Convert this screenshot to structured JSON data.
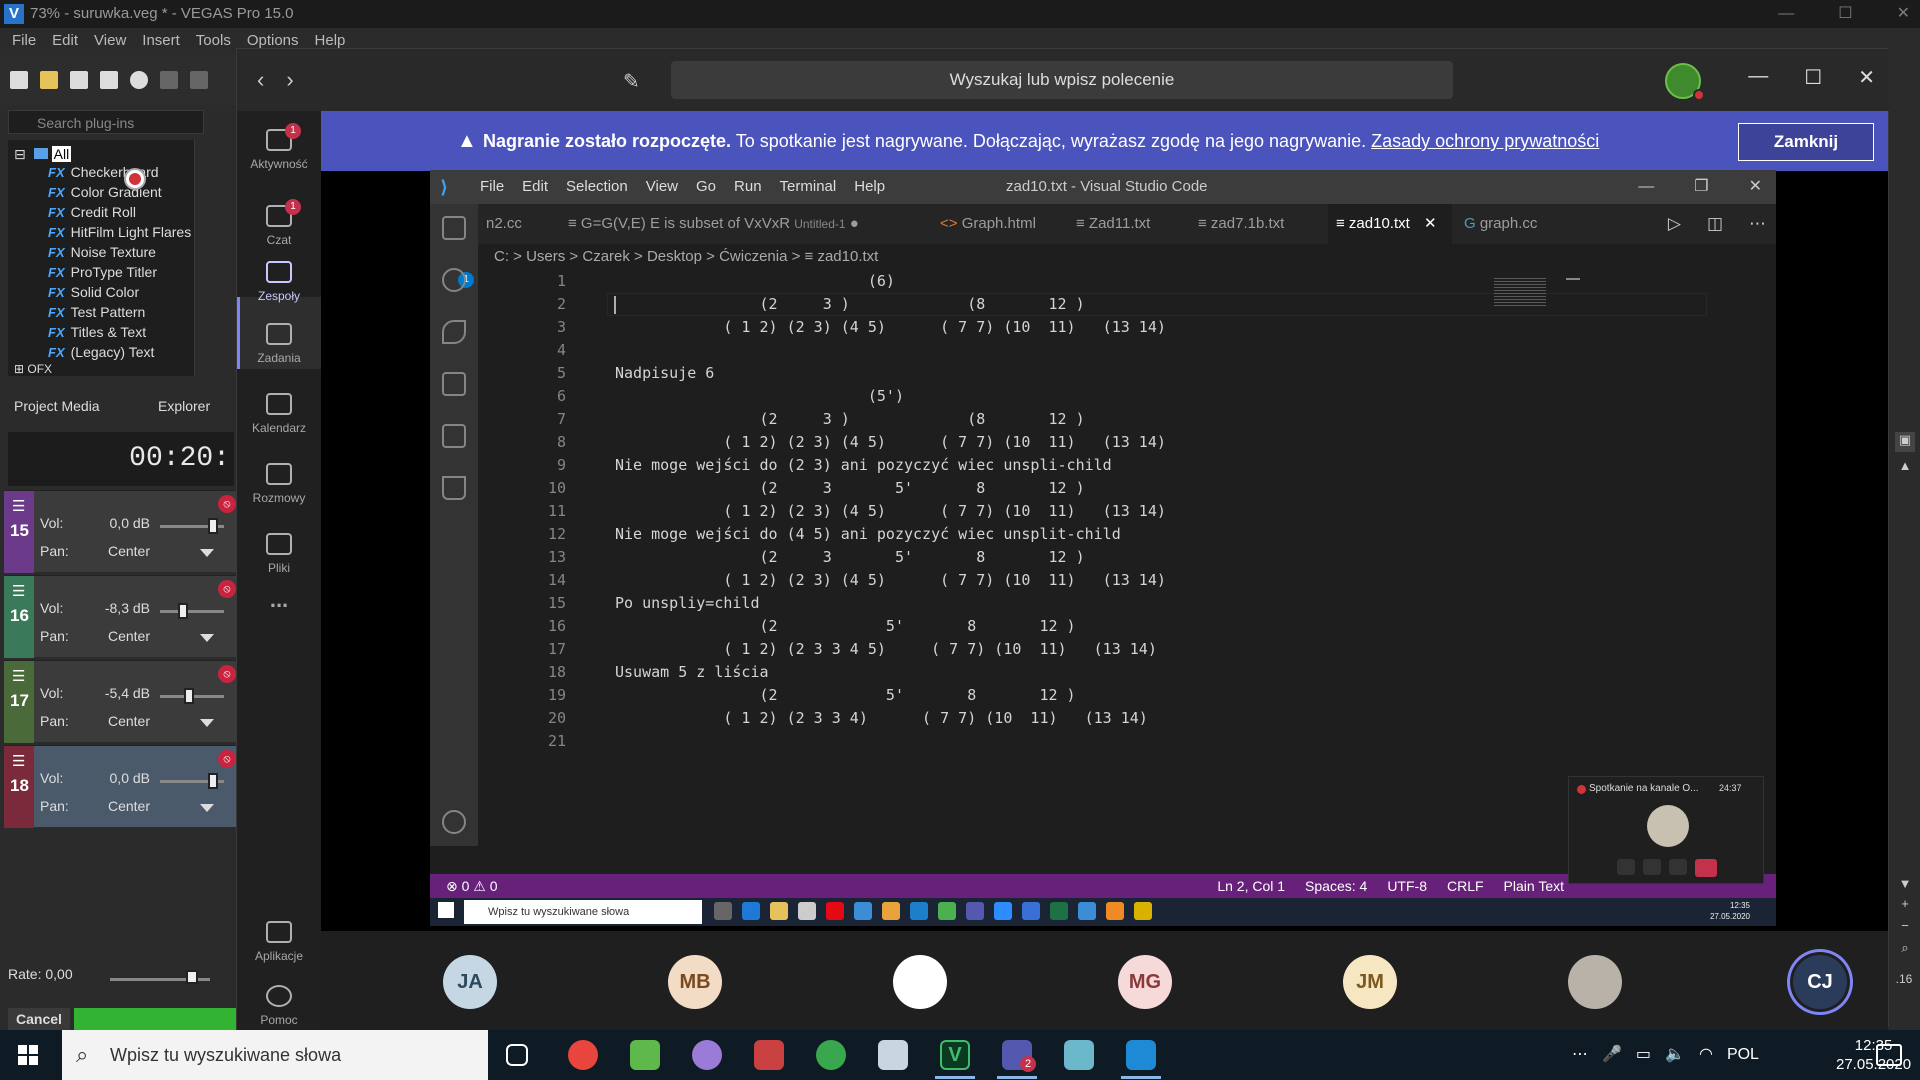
{
  "vegas": {
    "window_title": "73% - suruwka.veg * - VEGAS Pro 15.0",
    "menu": [
      "File",
      "Edit",
      "View",
      "Insert",
      "Tools",
      "Options",
      "Help"
    ],
    "search_placeholder": "Search plug-ins",
    "tree_root": "All",
    "plugins": [
      "Checkerboard",
      "Color Gradient",
      "Credit Roll",
      "HitFilm Light Flares",
      "Noise Texture",
      "ProType Titler",
      "Solid Color",
      "Test Pattern",
      "Titles & Text",
      "(Legacy) Text"
    ],
    "plugin_prefix": "FX",
    "tree_folder": "OFX",
    "panel_tabs": [
      "Project Media",
      "Explorer"
    ],
    "timecode": "00:20:",
    "tracks": [
      {
        "num": "15",
        "vol": "0,0 dB",
        "pan": "Center",
        "color": "#6b3a8a",
        "vol_level": 0.75
      },
      {
        "num": "16",
        "vol": "-8,3 dB",
        "pan": "Center",
        "color": "#3a7a5a",
        "vol_level": 0.35
      },
      {
        "num": "17",
        "vol": "-5,4 dB",
        "pan": "Center",
        "color": "#4b6a3a",
        "vol_level": 0.45
      },
      {
        "num": "18",
        "vol": "0,0 dB",
        "pan": "Center",
        "color": "#7a2a3a",
        "vol_level": 0.75
      }
    ],
    "vol_label": "Vol:",
    "pan_label": "Pan:",
    "rate_label": "Rate: 0,00",
    "cancel_label": "Cancel",
    "right_ruler": ".16"
  },
  "teams": {
    "search_placeholder": "Wyszukaj lub wpisz polecenie",
    "rail": [
      {
        "label": "Aktywność",
        "badge": "1"
      },
      {
        "label": "Czat",
        "badge": "1"
      },
      {
        "label": "Zespoły",
        "badge": ""
      },
      {
        "label": "Zadania",
        "badge": ""
      },
      {
        "label": "Kalendarz",
        "badge": ""
      },
      {
        "label": "Rozmowy",
        "badge": ""
      },
      {
        "label": "Pliki",
        "badge": ""
      },
      {
        "label": "...",
        "badge": ""
      },
      {
        "label": "Aplikacje",
        "badge": ""
      },
      {
        "label": "Pomoc",
        "badge": ""
      }
    ],
    "banner": {
      "bold": "Nagranie zostało rozpoczęte.",
      "text": "To spotkanie jest nagrywane. Dołączając, wyrażasz zgodę na jego nagrywanie.",
      "link": "Zasady ochrony prywatności",
      "close": "Zamknij"
    },
    "participants": [
      {
        "initials": "JA",
        "bg": "#c5d7e3",
        "fg": "#2c4a5e"
      },
      {
        "initials": "MB",
        "bg": "#f3dcc5",
        "fg": "#7a4a1e"
      },
      {
        "initials": "",
        "bg": "#ffffff",
        "fg": "#000000"
      },
      {
        "initials": "MG",
        "bg": "#f6d9d9",
        "fg": "#8a3a3a"
      },
      {
        "initials": "JM",
        "bg": "#f7e6c2",
        "fg": "#7a5a1e"
      },
      {
        "initials": "",
        "bg": "#b9b2a8",
        "fg": "#000000"
      },
      {
        "initials": "CJ",
        "bg": "#2b3c5a",
        "fg": "#ffffff"
      }
    ],
    "mini_call": {
      "title": "Spotkanie na kanale O...",
      "time": "24:37"
    }
  },
  "vscode": {
    "menu": [
      "File",
      "Edit",
      "Selection",
      "View",
      "Go",
      "Run",
      "Terminal",
      "Help"
    ],
    "title": "zad10.txt - Visual Studio Code",
    "explorer_badge": "1",
    "tabs": [
      {
        "label": "n2.cc",
        "active": false
      },
      {
        "label": "G=G(V,E) E is subset of VxVxR",
        "extra": "Untitled-1",
        "active": false
      },
      {
        "label": "Graph.html",
        "active": false
      },
      {
        "label": "Zad11.txt",
        "active": false
      },
      {
        "label": "zad7.1b.txt",
        "active": false
      },
      {
        "label": "zad10.txt",
        "active": true
      },
      {
        "label": "graph.cc",
        "active": false
      }
    ],
    "breadcrumb": "C: > Users > Czarek > Desktop > Ćwiczenia > ≡ zad10.txt",
    "lines": [
      "                            (6)",
      "                (2     3 )             (8       12 )",
      "            ( 1 2) (2 3) (4 5)      ( 7 7) (10  11)   (13 14)",
      "",
      "Nadpisuje 6",
      "                            (5')",
      "                (2     3 )             (8       12 )",
      "            ( 1 2) (2 3) (4 5)      ( 7 7) (10  11)   (13 14)",
      "Nie moge wejści do (2 3) ani pozyczyć wiec unspli-child",
      "                (2     3       5'       8       12 )",
      "            ( 1 2) (2 3) (4 5)      ( 7 7) (10  11)   (13 14)",
      "Nie moge wejści do (4 5) ani pozyczyć wiec unsplit-child",
      "                (2     3       5'       8       12 )",
      "            ( 1 2) (2 3) (4 5)      ( 7 7) (10  11)   (13 14)",
      "Po unspliy=child",
      "                (2            5'       8       12 )",
      "            ( 1 2) (2 3 3 4 5)     ( 7 7) (10  11)   (13 14)",
      "Usuwam 5 z liścia",
      "                (2            5'       8       12 )",
      "            ( 1 2) (2 3 3 4)      ( 7 7) (10  11)   (13 14)",
      ""
    ],
    "status_left": "⊗ 0 ⚠ 0",
    "status_right": [
      "Ln 2, Col 1",
      "Spaces: 4",
      "UTF-8",
      "CRLF",
      "Plain Text"
    ]
  },
  "inner_taskbar": {
    "search_placeholder": "Wpisz tu wyszukiwane słowa",
    "time": "12:35",
    "date": "27.05.2020"
  },
  "taskbar": {
    "search_placeholder": "Wpisz tu wyszukiwane słowa",
    "lang": "POL",
    "time": "12:35",
    "date": "27.05.2020",
    "teams_badge": "2"
  }
}
